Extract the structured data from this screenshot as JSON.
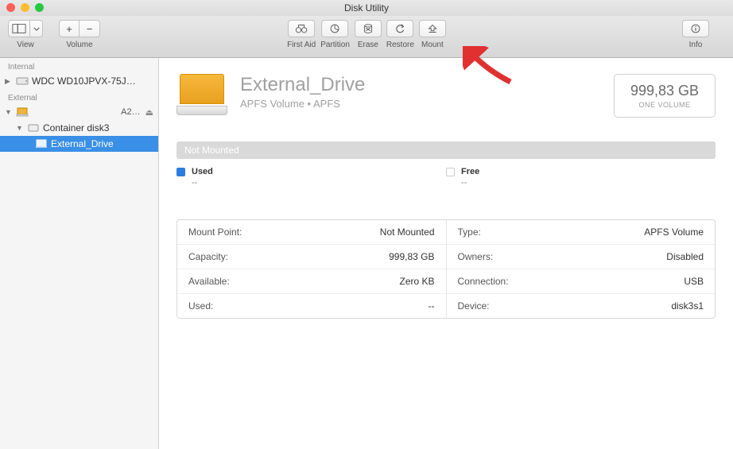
{
  "window": {
    "title": "Disk Utility"
  },
  "toolbar": {
    "view_label": "View",
    "volume_label": "Volume",
    "firstaid_label": "First Aid",
    "partition_label": "Partition",
    "erase_label": "Erase",
    "restore_label": "Restore",
    "mount_label": "Mount",
    "info_label": "Info"
  },
  "sidebar": {
    "internal_header": "Internal",
    "external_header": "External",
    "internal_disk": "WDC WD10JPVX-75J…",
    "external_disk_size": "A2…",
    "container_label": "Container disk3",
    "volume_label": "External_Drive"
  },
  "volume": {
    "name": "External_Drive",
    "subtitle": "APFS Volume • APFS",
    "size": "999,83 GB",
    "size_sub": "ONE VOLUME",
    "status": "Not Mounted",
    "used_label": "Used",
    "used_value": "--",
    "free_label": "Free",
    "free_value": "--"
  },
  "details": {
    "left": [
      {
        "k": "Mount Point:",
        "v": "Not Mounted"
      },
      {
        "k": "Capacity:",
        "v": "999,83 GB"
      },
      {
        "k": "Available:",
        "v": "Zero KB"
      },
      {
        "k": "Used:",
        "v": "--"
      }
    ],
    "right": [
      {
        "k": "Type:",
        "v": "APFS Volume"
      },
      {
        "k": "Owners:",
        "v": "Disabled"
      },
      {
        "k": "Connection:",
        "v": "USB"
      },
      {
        "k": "Device:",
        "v": "disk3s1"
      }
    ]
  }
}
